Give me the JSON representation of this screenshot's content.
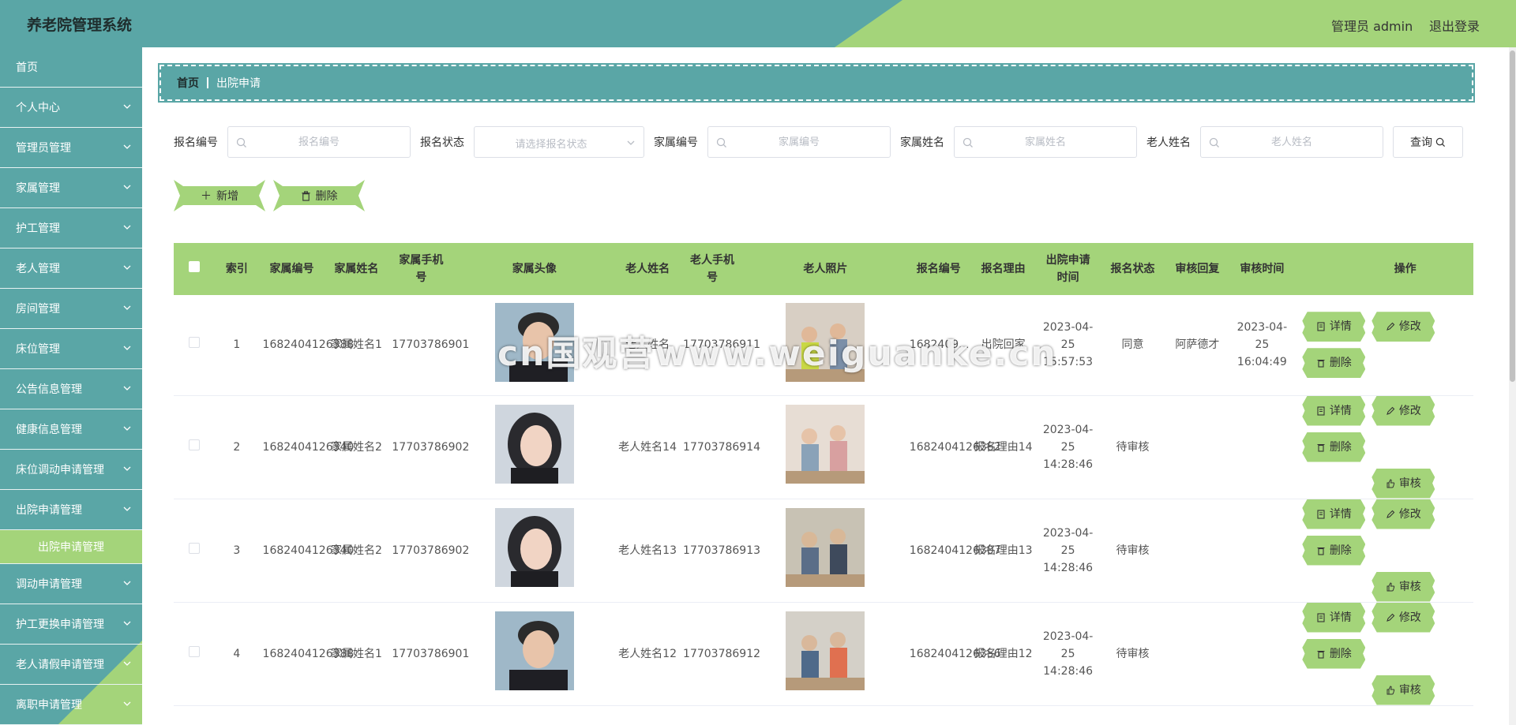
{
  "header": {
    "title": "养老院管理系统",
    "user": "管理员 admin",
    "logout": "退出登录"
  },
  "sidebar": {
    "items": [
      {
        "label": "首页",
        "chevron": false
      },
      {
        "label": "个人中心",
        "chevron": true
      },
      {
        "label": "管理员管理",
        "chevron": true
      },
      {
        "label": "家属管理",
        "chevron": true
      },
      {
        "label": "护工管理",
        "chevron": true
      },
      {
        "label": "老人管理",
        "chevron": true
      },
      {
        "label": "房间管理",
        "chevron": true
      },
      {
        "label": "床位管理",
        "chevron": true
      },
      {
        "label": "公告信息管理",
        "chevron": true
      },
      {
        "label": "健康信息管理",
        "chevron": true
      },
      {
        "label": "床位调动申请管理",
        "chevron": true
      },
      {
        "label": "出院申请管理",
        "chevron": true
      }
    ],
    "sub_active": "出院申请管理",
    "items_after": [
      {
        "label": "调动申请管理"
      },
      {
        "label": "护工更换申请管理"
      },
      {
        "label": "老人请假申请管理"
      },
      {
        "label": "离职申请管理"
      }
    ]
  },
  "breadcrumb": {
    "home": "首页",
    "current": "出院申请"
  },
  "search": {
    "f1_label": "报名编号",
    "f1_placeholder": "报名编号",
    "f2_label": "报名状态",
    "f2_placeholder": "请选择报名状态",
    "f3_label": "家属编号",
    "f3_placeholder": "家属编号",
    "f4_label": "家属姓名",
    "f4_placeholder": "家属姓名",
    "f5_label": "老人姓名",
    "f5_placeholder": "老人姓名",
    "query": "查询"
  },
  "actions": {
    "add": "新增",
    "delete": "删除"
  },
  "table": {
    "headers": [
      "索引",
      "家属编号",
      "家属姓名",
      "家属手机号",
      "家属头像",
      "老人姓名",
      "老人手机号",
      "老人照片",
      "报名编号",
      "报名理由",
      "出院申请时间",
      "报名状态",
      "审核回复",
      "审核时间",
      "操作"
    ],
    "op_labels": {
      "detail": "详情",
      "edit": "修改",
      "delete": "删除",
      "review": "审核"
    },
    "rows": [
      {
        "index": "1",
        "family_no": "1682404126388",
        "family_name": "家属姓名1",
        "family_phone": "17703786901",
        "elder_name": "老人姓名",
        "elder_phone": "17703786911",
        "reg_no": "1682409...",
        "reason": "出院回家",
        "time": "2023-04-25 15:57:53",
        "status": "同意",
        "reply": "阿萨德才",
        "review_time": "2023-04-25 16:04:49"
      },
      {
        "index": "2",
        "family_no": "1682404126340",
        "family_name": "家属姓名2",
        "family_phone": "17703786902",
        "elder_name": "老人姓名14",
        "elder_phone": "17703786914",
        "reg_no": "1682404126362",
        "reason": "报名理由14",
        "time": "2023-04-25 14:28:46",
        "status": "待审核",
        "reply": "",
        "review_time": ""
      },
      {
        "index": "3",
        "family_no": "1682404126340",
        "family_name": "家属姓名2",
        "family_phone": "17703786902",
        "elder_name": "老人姓名13",
        "elder_phone": "17703786913",
        "reg_no": "1682404126307",
        "reason": "报名理由13",
        "time": "2023-04-25 14:28:46",
        "status": "待审核",
        "reply": "",
        "review_time": ""
      },
      {
        "index": "4",
        "family_no": "1682404126388",
        "family_name": "家属姓名1",
        "family_phone": "17703786901",
        "elder_name": "老人姓名12",
        "elder_phone": "17703786912",
        "reg_no": "1682404126356",
        "reason": "报名理由12",
        "time": "2023-04-25 14:28:46",
        "status": "待审核",
        "reply": "",
        "review_time": ""
      }
    ]
  },
  "watermark": "cn国观营www.weiguanke.cn",
  "colors": {
    "teal": "#5aa6a6",
    "green": "#a4d47a"
  }
}
